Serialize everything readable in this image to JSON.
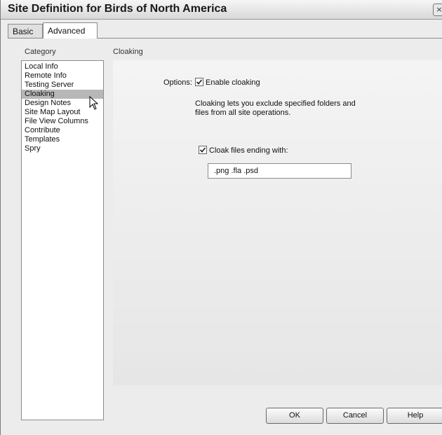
{
  "window": {
    "title": "Site Definition for Birds of North America",
    "close_glyph": "×"
  },
  "tabs": [
    {
      "label": "Basic",
      "active": false
    },
    {
      "label": "Advanced",
      "active": true
    }
  ],
  "category_panel": {
    "header": "Category",
    "items": [
      {
        "label": "Local Info",
        "selected": false
      },
      {
        "label": "Remote Info",
        "selected": false
      },
      {
        "label": "Testing Server",
        "selected": false
      },
      {
        "label": "Cloaking",
        "selected": true
      },
      {
        "label": "Design Notes",
        "selected": false
      },
      {
        "label": "Site Map Layout",
        "selected": false
      },
      {
        "label": "File View Columns",
        "selected": false
      },
      {
        "label": "Contribute",
        "selected": false
      },
      {
        "label": "Templates",
        "selected": false
      },
      {
        "label": "Spry",
        "selected": false
      }
    ]
  },
  "cloaking": {
    "header": "Cloaking",
    "options_label": "Options:",
    "enable_label": "Enable cloaking",
    "enable_checked": true,
    "description_lines": [
      "Cloaking lets you exclude specified folders and",
      "files from all site operations."
    ],
    "cloak_files_label": "Cloak files ending with:",
    "cloak_files_checked": true,
    "extensions_value": ".png .fla .psd"
  },
  "buttons": {
    "ok": "OK",
    "cancel": "Cancel",
    "help": "Help"
  },
  "colors": {
    "selection": "#b7b7b7",
    "panel_bg": "#ececec"
  }
}
